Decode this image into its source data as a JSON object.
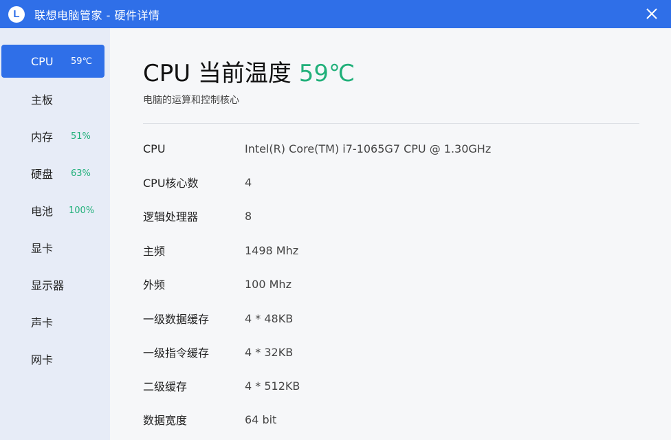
{
  "app": {
    "logo_letter": "L",
    "title": "联想电脑管家 - 硬件详情"
  },
  "sidebar": {
    "items": [
      {
        "label": "CPU",
        "value": "59℃",
        "active": true
      },
      {
        "label": "主板",
        "value": ""
      },
      {
        "label": "内存",
        "value": "51%"
      },
      {
        "label": "硬盘",
        "value": "63%"
      },
      {
        "label": "电池",
        "value": "100%"
      },
      {
        "label": "显卡",
        "value": ""
      },
      {
        "label": "显示器",
        "value": ""
      },
      {
        "label": "声卡",
        "value": ""
      },
      {
        "label": "网卡",
        "value": ""
      }
    ]
  },
  "main": {
    "heading_prefix": "CPU 当前温度",
    "heading_temp": "59℃",
    "subtitle": "电脑的运算和控制核心",
    "specs": [
      {
        "key": "CPU",
        "value": "Intel(R) Core(TM) i7-1065G7 CPU @ 1.30GHz"
      },
      {
        "key": "CPU核心数",
        "value": "4"
      },
      {
        "key": "逻辑处理器",
        "value": "8"
      },
      {
        "key": "主频",
        "value": "1498 Mhz"
      },
      {
        "key": "外频",
        "value": "100 Mhz"
      },
      {
        "key": "一级数据缓存",
        "value": "4 * 48KB"
      },
      {
        "key": "一级指令缓存",
        "value": "4 * 32KB"
      },
      {
        "key": "二级缓存",
        "value": "4 * 512KB"
      },
      {
        "key": "数据宽度",
        "value": "64 bit"
      }
    ]
  },
  "colors": {
    "accent": "#2f6fe8",
    "value_green": "#21b07a",
    "sidebar_bg": "#e7ecf7"
  },
  "icons": {
    "logo": "lenovo-logo-icon",
    "close": "close-icon"
  }
}
